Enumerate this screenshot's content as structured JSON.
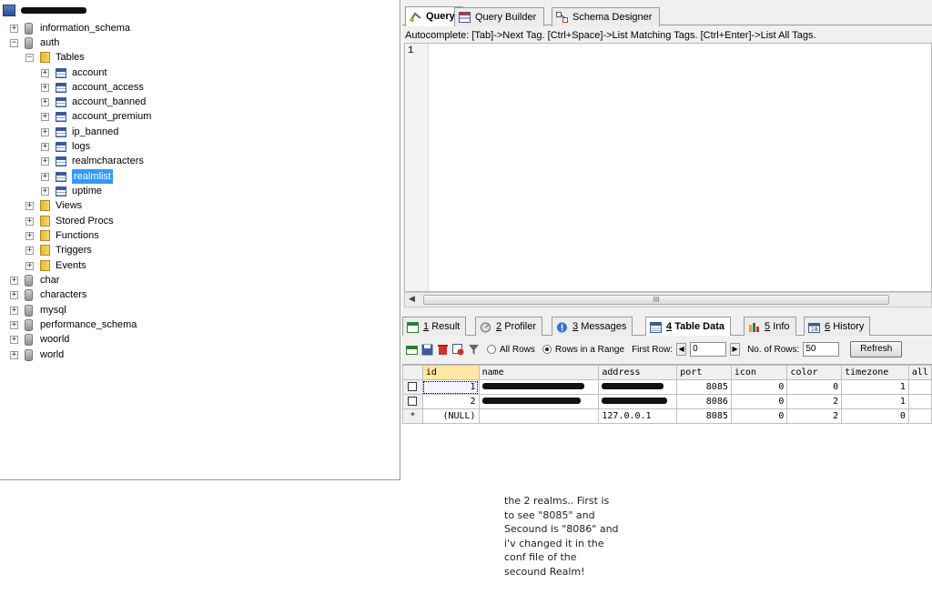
{
  "tree": {
    "server": {
      "label": ""
    },
    "items": [
      {
        "label": "information_schema",
        "type": "db",
        "exp": "+"
      },
      {
        "label": "auth",
        "type": "db",
        "exp": "−"
      },
      {
        "label": "Tables",
        "type": "folder",
        "exp": "−"
      },
      {
        "label": "account",
        "type": "table",
        "exp": "+"
      },
      {
        "label": "account_access",
        "type": "table",
        "exp": "+"
      },
      {
        "label": "account_banned",
        "type": "table",
        "exp": "+"
      },
      {
        "label": "account_premium",
        "type": "table",
        "exp": "+"
      },
      {
        "label": "ip_banned",
        "type": "table",
        "exp": "+"
      },
      {
        "label": "logs",
        "type": "table",
        "exp": "+"
      },
      {
        "label": "realmcharacters",
        "type": "table",
        "exp": "+"
      },
      {
        "label": "realmlist",
        "type": "table",
        "exp": "+",
        "selected": true
      },
      {
        "label": "uptime",
        "type": "table",
        "exp": "+"
      },
      {
        "label": "Views",
        "type": "folder",
        "exp": "+"
      },
      {
        "label": "Stored Procs",
        "type": "folder",
        "exp": "+"
      },
      {
        "label": "Functions",
        "type": "folder",
        "exp": "+"
      },
      {
        "label": "Triggers",
        "type": "folder",
        "exp": "+"
      },
      {
        "label": "Events",
        "type": "folder",
        "exp": "+"
      },
      {
        "label": "char",
        "type": "db",
        "exp": "+"
      },
      {
        "label": "characters",
        "type": "db",
        "exp": "+"
      },
      {
        "label": "mysql",
        "type": "db",
        "exp": "+"
      },
      {
        "label": "performance_schema",
        "type": "db",
        "exp": "+"
      },
      {
        "label": "woorld",
        "type": "db",
        "exp": "+"
      },
      {
        "label": "world",
        "type": "db",
        "exp": "+"
      }
    ]
  },
  "query_tabs": {
    "query": "Query",
    "builder": "Query Builder",
    "designer": "Schema Designer"
  },
  "autocomplete_hint": "Autocomplete: [Tab]->Next Tag. [Ctrl+Space]->List Matching Tags. [Ctrl+Enter]->List All Tags.",
  "editor": {
    "line_number": "1"
  },
  "scrollbar": {
    "thumb_grip": "III"
  },
  "result_tabs": [
    {
      "num": "1",
      "label": "Result"
    },
    {
      "num": "2",
      "label": "Profiler"
    },
    {
      "num": "3",
      "label": "Messages"
    },
    {
      "num": "4",
      "label": "Table Data"
    },
    {
      "num": "5",
      "label": "Info"
    },
    {
      "num": "6",
      "label": "History"
    }
  ],
  "toolbar": {
    "all_rows": "All Rows",
    "rows_in_range": "Rows in a Range",
    "first_row_label": "First Row:",
    "first_row_value": "0",
    "num_rows_label": "No. of Rows:",
    "num_rows_value": "50",
    "refresh": "Refresh"
  },
  "grid": {
    "columns": [
      "id",
      "name",
      "address",
      "port",
      "icon",
      "color",
      "timezone",
      "all"
    ],
    "rows": [
      {
        "id": "1",
        "name": "",
        "address": "",
        "port": "8085",
        "icon": "0",
        "color": "0",
        "timezone": "1"
      },
      {
        "id": "2",
        "name": "",
        "address": "",
        "port": "8086",
        "icon": "0",
        "color": "2",
        "timezone": "1"
      },
      {
        "marker": "*",
        "id": "(NULL)",
        "name": "",
        "address": "127.0.0.1",
        "port": "8085",
        "icon": "0",
        "color": "2",
        "timezone": "0"
      }
    ]
  },
  "caption": {
    "lines": [
      "the 2 realms.. First is",
      "to see \"8085\" and",
      "Secound is \"8086\" and",
      "i'v changed it in the",
      "conf file of the",
      "secound Realm!"
    ]
  },
  "colors": {
    "selection": "#3399ff",
    "header_highlight": "#fde7a3",
    "panel_bg": "#f0f0f0"
  }
}
